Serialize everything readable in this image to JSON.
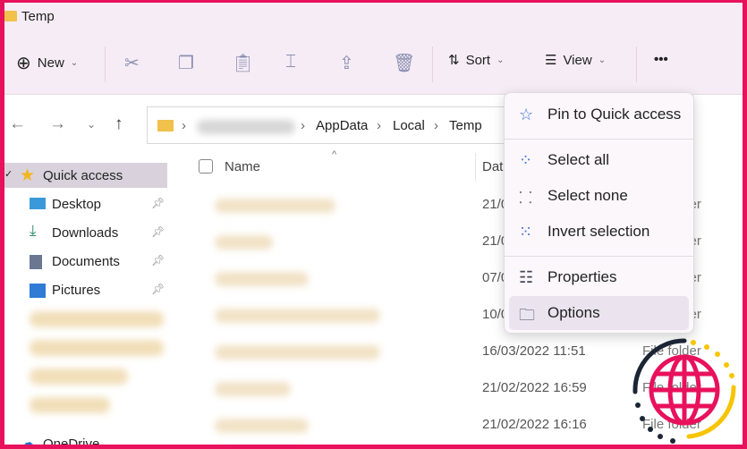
{
  "window": {
    "title": "Temp"
  },
  "toolbar": {
    "new_label": "New",
    "sort_label": "Sort",
    "view_label": "View",
    "more_label": "•••"
  },
  "address": {
    "segments": [
      "AppData",
      "Local",
      "Temp"
    ]
  },
  "sidebar": {
    "quick_access": "Quick access",
    "items": [
      {
        "label": "Desktop",
        "icon": "desktop-icon"
      },
      {
        "label": "Downloads",
        "icon": "download-icon"
      },
      {
        "label": "Documents",
        "icon": "document-icon"
      },
      {
        "label": "Pictures",
        "icon": "pictures-icon"
      }
    ],
    "onedrive": "OneDrive"
  },
  "columns": {
    "name": "Name",
    "date": "Date"
  },
  "rows": [
    {
      "date": "21/0",
      "type": "File folder"
    },
    {
      "date": "21/0",
      "type": "File folder"
    },
    {
      "date": "07/0",
      "type": "File folder"
    },
    {
      "date": "10/0",
      "type": "File folder"
    },
    {
      "date": "16/03/2022 11:51",
      "type": "File folder"
    },
    {
      "date": "21/02/2022 16:59",
      "type": "File folder"
    },
    {
      "date": "21/02/2022 16:16",
      "type": "File folder"
    }
  ],
  "menu": {
    "items": [
      {
        "label": "Pin to Quick access",
        "icon": "star-icon"
      },
      {
        "label": "Select all",
        "icon": "select-all-icon"
      },
      {
        "label": "Select none",
        "icon": "select-none-icon"
      },
      {
        "label": "Invert selection",
        "icon": "invert-selection-icon"
      },
      {
        "label": "Properties",
        "icon": "properties-icon"
      },
      {
        "label": "Options",
        "icon": "folder-options-icon"
      }
    ]
  },
  "colors": {
    "border": "#e8115b",
    "accent": "#3b6fd4"
  }
}
